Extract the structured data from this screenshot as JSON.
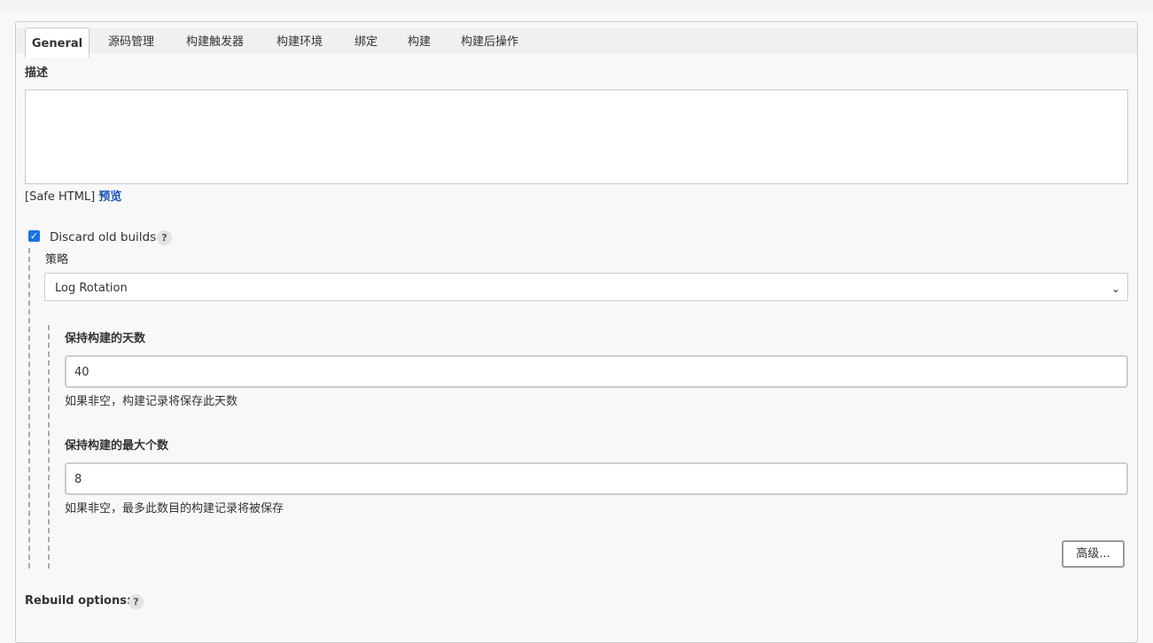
{
  "tabs": [
    {
      "label": "General"
    },
    {
      "label": "源码管理"
    },
    {
      "label": "构建触发器"
    },
    {
      "label": "构建环境"
    },
    {
      "label": "绑定"
    },
    {
      "label": "构建"
    },
    {
      "label": "构建后操作"
    }
  ],
  "general": {
    "description_label": "描述",
    "description_value": "",
    "safe_html": "[Safe HTML]",
    "preview_link": "预览",
    "discard_old_builds": {
      "label": "Discard old builds",
      "checked": true,
      "help": "?",
      "strategy_label": "策略",
      "strategy_value": "Log Rotation",
      "days_label": "保持构建的天数",
      "days_value": "40",
      "days_hint": "如果非空，构建记录将保存此天数",
      "max_label": "保持构建的最大个数",
      "max_value": "8",
      "max_hint": "如果非空，最多此数目的构建记录将被保存",
      "advanced_button": "高级..."
    },
    "rebuild_options_label": "Rebuild options:",
    "rebuild_help": "?"
  },
  "icons": {
    "checkbox": "check-icon",
    "select": "chevron-down-icon",
    "help": "question-icon"
  }
}
